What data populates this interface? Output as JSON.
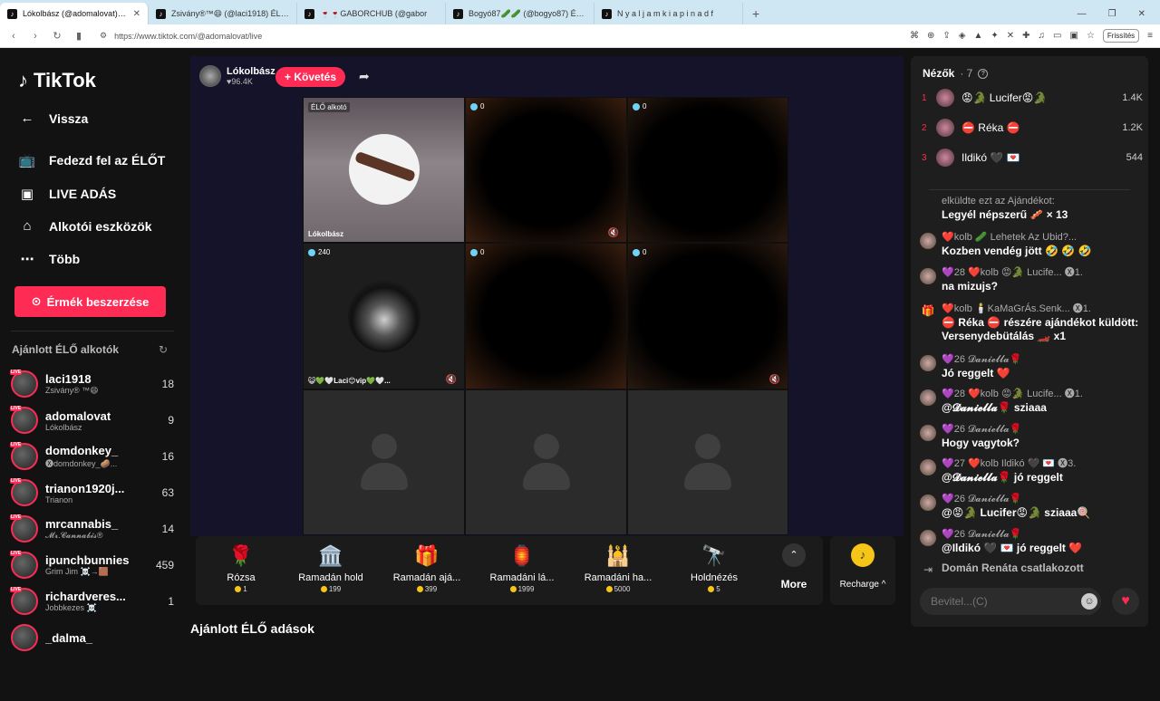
{
  "browser": {
    "tabs": [
      {
        "icon": "tiktok-icon",
        "label": "Lókolbász (@adomalovat) ÉL",
        "active": true
      },
      {
        "icon": "tiktok-icon",
        "label": "Zsivány®™😄 (@laci1918) ÉLŐ adás",
        "active": false
      },
      {
        "icon": "tiktok-icon",
        "label": "🍷🍷GABORCHUB (@gabor",
        "active": false
      },
      {
        "icon": "tiktok-icon",
        "label": "Bogyó87🥒🥒 (@bogyo87) ÉLŐ",
        "active": false
      },
      {
        "icon": "tiktok-icon",
        "label": "N y a l j a m k i a p i n a d f",
        "active": false
      }
    ],
    "new_tab": "+",
    "url": "https://www.tiktok.com/@adomalovat/live",
    "refresh_label": "Frissítés"
  },
  "sidebar": {
    "logo": "TikTok",
    "nav": [
      {
        "icon": "arrow-left-icon",
        "label": "Vissza"
      },
      {
        "icon": "live-tv-icon",
        "label": "Fedezd fel az ÉLŐT"
      },
      {
        "icon": "camera-icon",
        "label": "LIVE ADÁS"
      },
      {
        "icon": "home-tools-icon",
        "label": "Alkotói eszközök"
      },
      {
        "icon": "more-icon",
        "label": "Több"
      }
    ],
    "coin_button": "Érmék beszerzése",
    "recommended_title": "Ajánlott ÉLŐ alkotók",
    "live_tag": "LIVE",
    "creators": [
      {
        "name": "laci1918",
        "sub": "Zsivány® ™😄",
        "count": "18"
      },
      {
        "name": "adomalovat",
        "sub": "Lókolbász",
        "count": "9"
      },
      {
        "name": "domdonkey_",
        "sub": "🅧domdonkey_🥔...",
        "count": "16"
      },
      {
        "name": "trianon1920j...",
        "sub": "Trianon",
        "count": "63"
      },
      {
        "name": "mrcannabis_",
        "sub": "𝓜𝓻.𝓒𝓪𝓷𝓷𝓪𝓫𝓲𝓼®",
        "count": "14"
      },
      {
        "name": "ipunchbunnies",
        "sub": "Grim Jim ☠️→🟫",
        "count": "459"
      },
      {
        "name": "richardveres...",
        "sub": "Jobbkezes ☠️",
        "count": "1"
      },
      {
        "name": "_dalma_",
        "sub": "",
        "count": ""
      }
    ]
  },
  "stream": {
    "host_name": "Lókolbász",
    "host_likes": "96.4K",
    "follow_label": "+ Követés",
    "cells": [
      {
        "badge": "ÉLŐ alkotó",
        "name": "Lókolbász",
        "type": "host"
      },
      {
        "badge": "0",
        "name": "",
        "type": "dark"
      },
      {
        "badge": "0",
        "name": "",
        "type": "dark"
      },
      {
        "badge": "240",
        "name": "😺💚🤍Laci😊vip💚🤍...",
        "type": "hood"
      },
      {
        "badge": "0",
        "name": "",
        "type": "dark"
      },
      {
        "badge": "0",
        "name": "",
        "type": "dark"
      },
      {
        "badge": "",
        "name": "",
        "type": "empty"
      },
      {
        "badge": "",
        "name": "",
        "type": "empty"
      },
      {
        "badge": "",
        "name": "",
        "type": "empty"
      }
    ],
    "gifts": [
      {
        "icon": "🌹",
        "name": "Rózsa",
        "price": "1"
      },
      {
        "icon": "🏛️",
        "name": "Ramadán hold",
        "price": "199"
      },
      {
        "icon": "🎁",
        "name": "Ramadán ajá...",
        "price": "399"
      },
      {
        "icon": "🏮",
        "name": "Ramadáni lá...",
        "price": "1999"
      },
      {
        "icon": "🕌",
        "name": "Ramadáni ha...",
        "price": "5000"
      },
      {
        "icon": "🔭",
        "name": "Holdnézés",
        "price": "5"
      }
    ],
    "more_label": "More",
    "recharge_label": "Recharge ^",
    "suggested_title": "Ajánlott ÉLŐ adások"
  },
  "chat": {
    "viewers_label": "Nézők",
    "viewers_count": "· 7",
    "top_viewers": [
      {
        "rank": "1",
        "name": "😡🐊 Lucifer😡🐊",
        "score": "1.4K"
      },
      {
        "rank": "2",
        "name": "⛔ Réka ⛔",
        "score": "1.2K"
      },
      {
        "rank": "3",
        "name": "Ildikó 🖤 💌",
        "score": "544"
      }
    ],
    "messages": [
      {
        "avatar": "",
        "meta": "elküldte ezt az Ajándékot:",
        "text": "Legyél népszerű 🥓 × 13"
      },
      {
        "avatar": "avatar",
        "meta": "❤️kolb 🥒 Lehetek Az Ubid?...",
        "text": "Kozben vendég jött 🤣 🤣 🤣"
      },
      {
        "avatar": "avatar",
        "meta": "💜28 ❤️kolb 😡🐊 Lucife... 🅧1.",
        "text": "na mizujs?"
      },
      {
        "avatar": "gift",
        "meta": "❤️kolb 🕯️KaMaGrÁs.Senk... 🅧1.",
        "text": "⛔ Réka ⛔ részére ajándékot küldött: Versenydebütálás 🏎️ x1"
      },
      {
        "avatar": "avatar",
        "meta": "💜26 𝓓𝓪𝓷𝓲𝓮𝓵𝓵𝓪🌹",
        "text": "Jó reggelt ❤️"
      },
      {
        "avatar": "avatar",
        "meta": "💜28 ❤️kolb 😡🐊 Lucife... 🅧1.",
        "text": "@𝓓𝓪𝓷𝓲𝓮𝓵𝓵𝓪🌹 sziaaa"
      },
      {
        "avatar": "avatar",
        "meta": "💜26 𝓓𝓪𝓷𝓲𝓮𝓵𝓵𝓪🌹",
        "text": "Hogy vagytok?"
      },
      {
        "avatar": "avatar",
        "meta": "💜27 ❤️kolb Ildikó 🖤 💌 🅧3.",
        "text": "@𝓓𝓪𝓷𝓲𝓮𝓵𝓵𝓪🌹 jó reggelt"
      },
      {
        "avatar": "avatar",
        "meta": "💜26 𝓓𝓪𝓷𝓲𝓮𝓵𝓵𝓪🌹",
        "text": "@😡🐊 Lucifer😡🐊 sziaaa🍭"
      },
      {
        "avatar": "avatar",
        "meta": "💜26 𝓓𝓪𝓷𝓲𝓮𝓵𝓵𝓪🌹",
        "text": "@Ildikó 🖤 💌 jó reggelt ❤️"
      },
      {
        "avatar": "join",
        "meta": "",
        "text": "Domán Renáta  csatlakozott"
      }
    ],
    "input_placeholder": "Bevitel...(C)"
  }
}
